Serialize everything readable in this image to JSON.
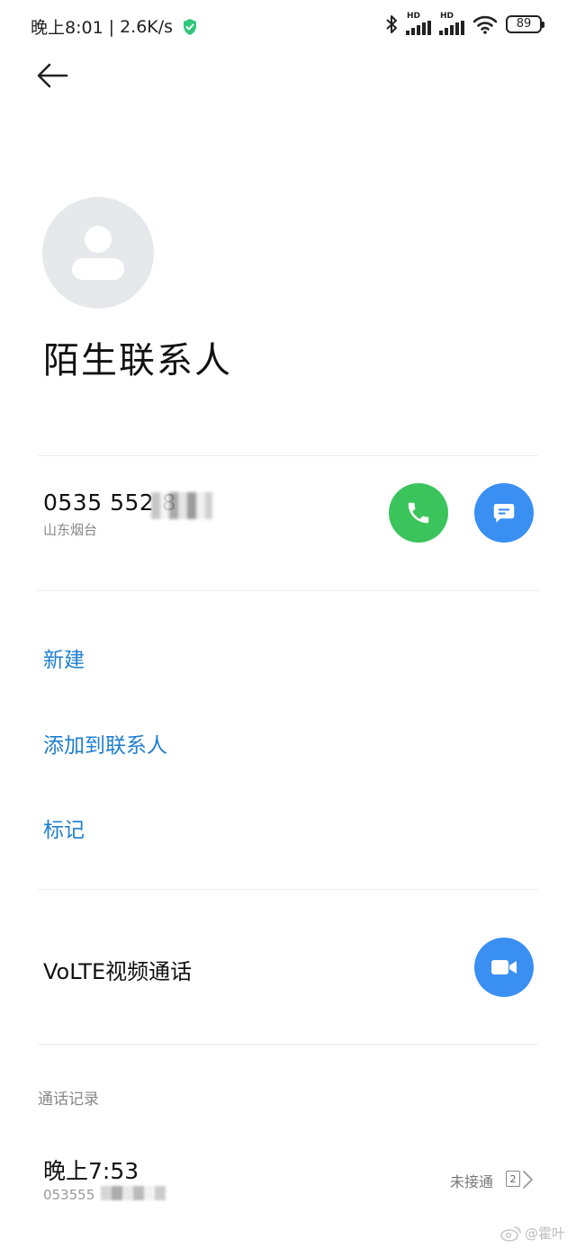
{
  "status_bar": {
    "time": "晚上8:01",
    "separator": "|",
    "speed": "2.6K/s",
    "sim1_badge": "HD",
    "sim2_badge": "HD",
    "battery": "89",
    "icons": [
      "shield-icon",
      "bluetooth-icon",
      "signal-icon",
      "signal-icon",
      "wifi-icon",
      "battery-icon"
    ]
  },
  "header": {
    "back_icon": "arrow-left-icon"
  },
  "contact": {
    "name": "陌生联系人",
    "avatar_icon": "person-icon",
    "phone": "0535 552 8",
    "location": "山东烟台"
  },
  "actions": {
    "new": "新建",
    "add_to_contacts": "添加到联系人",
    "mark": "标记"
  },
  "volte": {
    "label": "VoLTE视频通话",
    "icon": "video-camera-icon"
  },
  "call_log": {
    "section_label": "通话记录",
    "entries": [
      {
        "time": "晚上7:53",
        "number": "053555",
        "status": "未接通",
        "count": "2"
      }
    ]
  },
  "watermark": {
    "text": "@霍叶"
  },
  "colors": {
    "call_green": "#3bc45b",
    "action_blue": "#3a8ff2",
    "link_blue": "#1f7fd1",
    "avatar_bg": "#e6e8ec"
  }
}
